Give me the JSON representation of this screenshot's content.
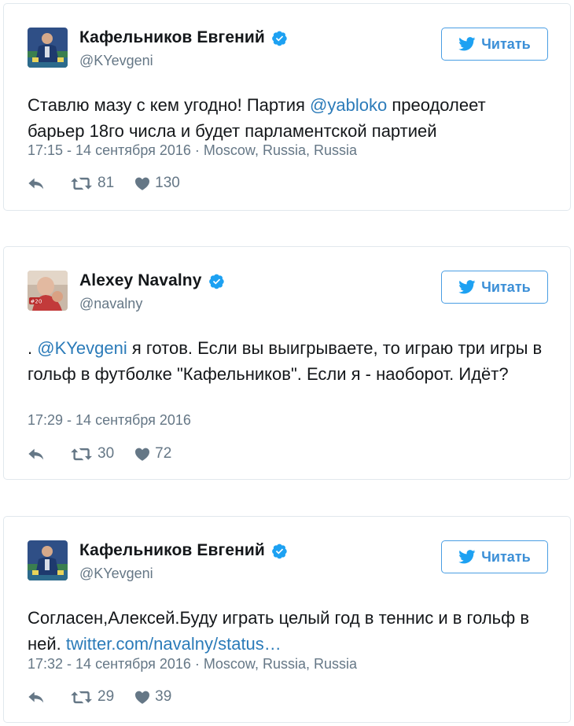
{
  "follow_label": "Читать",
  "colors": {
    "accent": "#2b7bb9",
    "verified": "#1da1f2",
    "muted": "#657786",
    "border": "#e1e8ed"
  },
  "tweets": [
    {
      "display_name": "Кафельников Евгений",
      "handle": "@KYevgeni",
      "verified": true,
      "avatar_icon": "avatar-kafelnikov",
      "text": {
        "part1": "Ставлю мазу с кем угодно! Партия ",
        "mention": "@yabloko",
        "part2": " преодолеет барьер 18го числа и будет парламентской партией"
      },
      "timestamp": "17:15 - 14 сентября 2016",
      "location": " · Moscow, Russia, Russia",
      "retweets": "81",
      "likes": "130"
    },
    {
      "display_name": "Alexey Navalny",
      "handle": "@navalny",
      "verified": true,
      "avatar_icon": "avatar-navalny",
      "text": {
        "part1": ". ",
        "mention": "@KYevgeni",
        "part2": " я готов. Если вы выигрываете, то играю три игры в гольф в футболке \"Кафельников\". Если я - наоборот. Идёт?"
      },
      "timestamp": "17:29 - 14 сентября 2016",
      "location": "",
      "retweets": "30",
      "likes": "72"
    },
    {
      "display_name": "Кафельников Евгений",
      "handle": "@KYevgeni",
      "verified": true,
      "avatar_icon": "avatar-kafelnikov",
      "text": {
        "part1": "Согласен,Алексей.Буду играть целый год в теннис и в гольф в ней. ",
        "mention": "twitter.com/navalny/status…",
        "part2": ""
      },
      "timestamp": "17:32 - 14 сентября 2016",
      "location": " · Moscow, Russia, Russia",
      "retweets": "29",
      "likes": "39"
    }
  ]
}
